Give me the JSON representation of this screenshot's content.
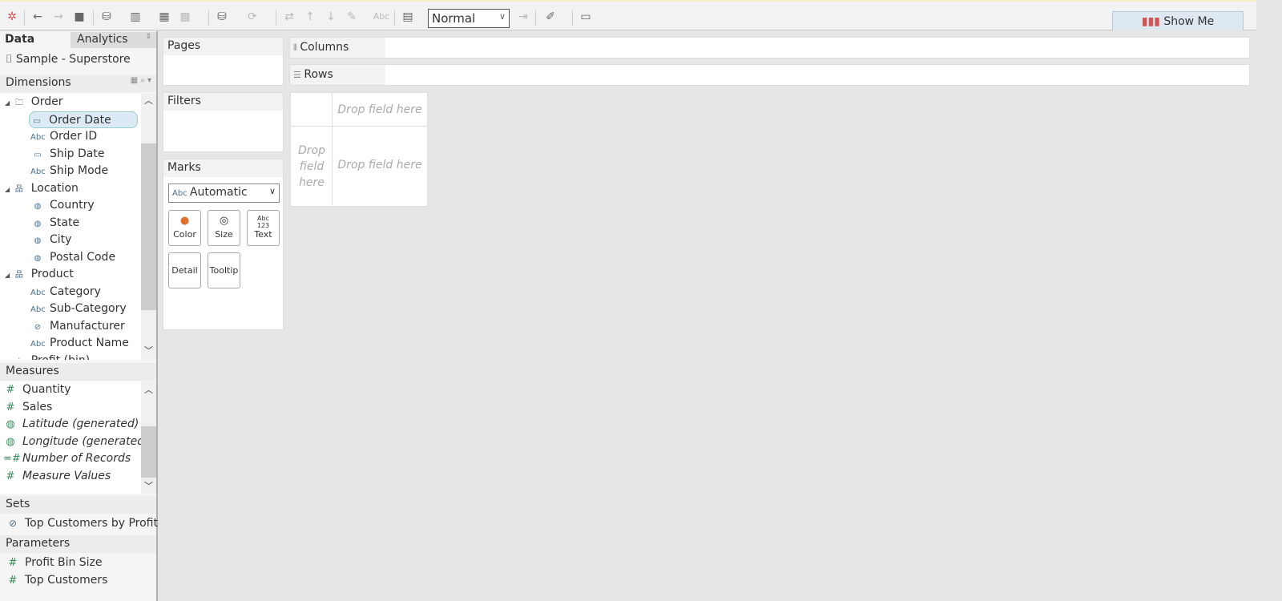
{
  "toolbar": {
    "fit_value": "Normal",
    "show_me": "Show Me"
  },
  "left": {
    "tabs": [
      "Data",
      "Analytics"
    ],
    "datasource": "Sample - Superstore",
    "dimensions_title": "Dimensions",
    "dimensions": [
      {
        "label": "Order",
        "icon": "folder",
        "level": 0
      },
      {
        "label": "Order Date",
        "icon": "calendar",
        "level": 1,
        "selected": true
      },
      {
        "label": "Order ID",
        "icon": "abc",
        "level": 1
      },
      {
        "label": "Ship Date",
        "icon": "calendar",
        "level": 1
      },
      {
        "label": "Ship Mode",
        "icon": "abc",
        "level": 1
      },
      {
        "label": "Location",
        "icon": "hierarchy",
        "level": 0
      },
      {
        "label": "Country",
        "icon": "globe",
        "level": 1
      },
      {
        "label": "State",
        "icon": "globe",
        "level": 1
      },
      {
        "label": "City",
        "icon": "globe",
        "level": 1
      },
      {
        "label": "Postal Code",
        "icon": "globe",
        "level": 1
      },
      {
        "label": "Product",
        "icon": "hierarchy",
        "level": 0
      },
      {
        "label": "Category",
        "icon": "abc",
        "level": 1
      },
      {
        "label": "Sub-Category",
        "icon": "abc",
        "level": 1
      },
      {
        "label": "Manufacturer",
        "icon": "paperclip",
        "level": 1
      },
      {
        "label": "Product Name",
        "icon": "abc",
        "level": 1
      },
      {
        "label": "Profit (bin)",
        "icon": "bin",
        "level": 0
      }
    ],
    "measures_title": "Measures",
    "measures": [
      {
        "label": "Quantity",
        "icon": "hash",
        "italic": false
      },
      {
        "label": "Sales",
        "icon": "hash",
        "italic": false
      },
      {
        "label": "Latitude (generated)",
        "icon": "globe",
        "italic": true
      },
      {
        "label": "Longitude (generated)",
        "icon": "globe",
        "italic": true
      },
      {
        "label": "Number of Records",
        "icon": "hash-calc",
        "italic": true
      },
      {
        "label": "Measure Values",
        "icon": "hash",
        "italic": true
      }
    ],
    "sets_title": "Sets",
    "sets": [
      "Top Customers by Profit"
    ],
    "parameters_title": "Parameters",
    "parameters": [
      "Profit Bin Size",
      "Top Customers"
    ]
  },
  "cards": {
    "pages": "Pages",
    "filters": "Filters",
    "marks": "Marks",
    "mark_type": "Automatic",
    "mark_buttons": [
      "Color",
      "Size",
      "Text",
      "Detail",
      "Tooltip"
    ]
  },
  "shelves": {
    "columns": "Columns",
    "rows": "Rows"
  },
  "view": {
    "drop_top": "Drop field here",
    "drop_left": "Drop field here",
    "drop_main": "Drop field here"
  }
}
